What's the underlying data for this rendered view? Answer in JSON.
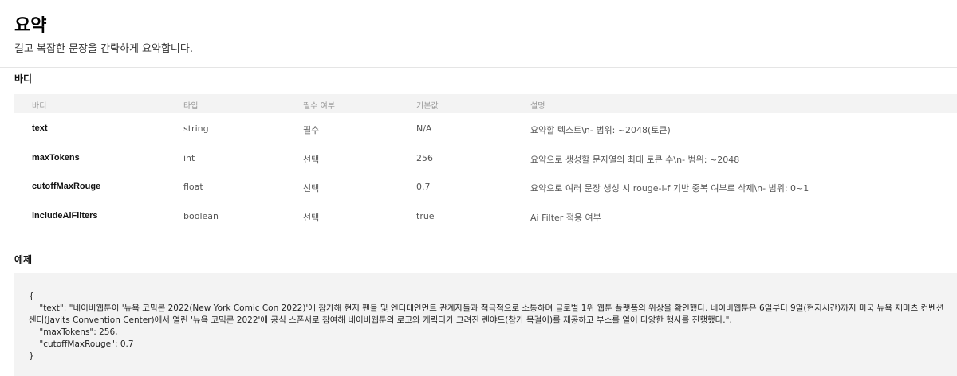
{
  "page": {
    "title": "요약",
    "subtitle": "길고 복잡한 문장을 간략하게 요약합니다."
  },
  "body_section": {
    "title": "바디",
    "columns": [
      "바디",
      "타입",
      "필수 여부",
      "기본값",
      "설명"
    ],
    "rows": [
      {
        "name": "text",
        "type": "string",
        "required": "필수",
        "default": "N/A",
        "description": "요약할 텍스트\\n- 범위: ~2048(토큰)"
      },
      {
        "name": "maxTokens",
        "type": "int",
        "required": "선택",
        "default": "256",
        "description": "요약으로 생성할 문자열의 최대 토큰 수\\n- 범위: ~2048"
      },
      {
        "name": "cutoffMaxRouge",
        "type": "float",
        "required": "선택",
        "default": "0.7",
        "description": "요약으로 여러 문장 생성 시 rouge-l-f 기반 중복 여부로 삭제\\n- 범위: 0~1"
      },
      {
        "name": "includeAiFilters",
        "type": "boolean",
        "required": "선택",
        "default": "true",
        "description": "Ai Filter 적용 여부"
      }
    ]
  },
  "example_section": {
    "title": "예제",
    "code": "{\n    \"text\": \"네이버웹툰이 '뉴욕 코믹콘 2022(New York Comic Con 2022)'에 참가해 현지 팬들 및 엔터테인먼트 관계자들과 적극적으로 소통하며 글로벌 1위 웹툰 플랫폼의 위상을 확인했다. 네이버웹툰은 6일부터 9일(현지시간)까지 미국 뉴욕 재미츠 컨벤션 센터(Javits Convention Center)에서 열린 '뉴욕 코믹콘 2022'에 공식 스폰서로 참여해 네이버웹툰의 로고와 캐릭터가 그려진 렌야드(참가 목걸이)를 제공하고 부스를 열어 다양한 행사를 진행했다.\",\n    \"maxTokens\": 256,\n    \"cutoffMaxRouge\": 0.7\n}"
  }
}
